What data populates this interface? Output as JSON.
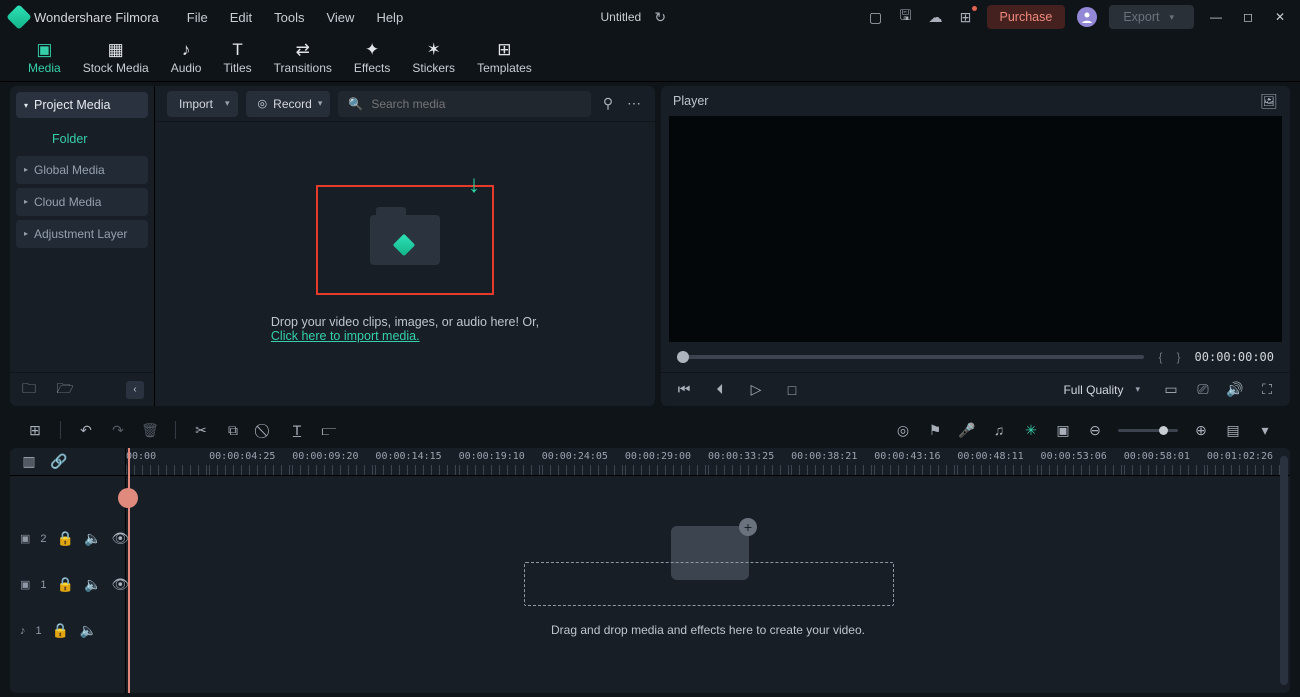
{
  "titlebar": {
    "app_name": "Wondershare Filmora",
    "menu": [
      "File",
      "Edit",
      "Tools",
      "View",
      "Help"
    ],
    "doc_title": "Untitled",
    "purchase_label": "Purchase",
    "export_label": "Export"
  },
  "maintabs": [
    {
      "label": "Media",
      "icon": "▣",
      "active": true
    },
    {
      "label": "Stock Media",
      "icon": "▦"
    },
    {
      "label": "Audio",
      "icon": "♪"
    },
    {
      "label": "Titles",
      "icon": "T"
    },
    {
      "label": "Transitions",
      "icon": "⇄"
    },
    {
      "label": "Effects",
      "icon": "✦"
    },
    {
      "label": "Stickers",
      "icon": "✶"
    },
    {
      "label": "Templates",
      "icon": "⊞"
    }
  ],
  "sidebar": {
    "head": "Project Media",
    "folder": "Folder",
    "items": [
      "Global Media",
      "Cloud Media",
      "Adjustment Layer"
    ]
  },
  "mediapanel": {
    "import_label": "Import",
    "record_label": "Record",
    "search_placeholder": "Search media",
    "drop_text": "Drop your video clips, images, or audio here! Or,",
    "drop_link": "Click here to import media."
  },
  "player": {
    "title": "Player",
    "timestamp": "00:00:00:00",
    "quality_label": "Full Quality"
  },
  "ruler_ticks": [
    "00:00",
    "00:00:04:25",
    "00:00:09:20",
    "00:00:14:15",
    "00:00:19:10",
    "00:00:24:05",
    "00:00:29:00",
    "00:00:33:25",
    "00:00:38:21",
    "00:00:43:16",
    "00:00:48:11",
    "00:00:53:06",
    "00:00:58:01",
    "00:01:02:26"
  ],
  "tracks": [
    {
      "icon": "▣",
      "num": "2"
    },
    {
      "icon": "▣",
      "num": "1"
    },
    {
      "icon": "♪",
      "num": "1"
    }
  ],
  "timeline_hint": "Drag and drop media and effects here to create your video."
}
